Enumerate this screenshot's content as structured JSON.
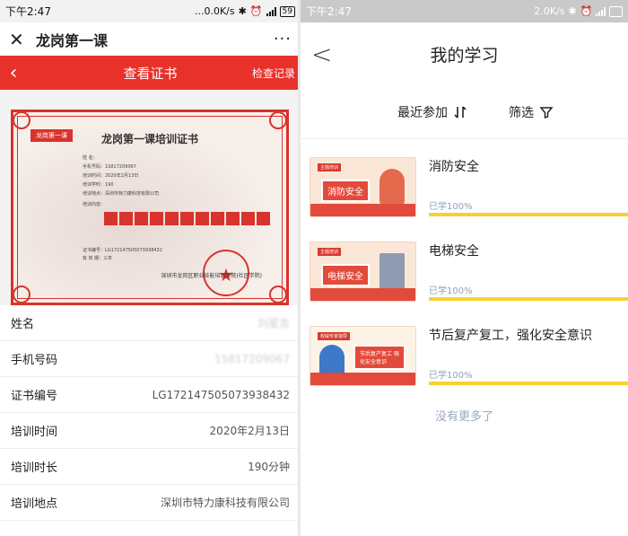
{
  "left": {
    "status": {
      "time": "下午2:47",
      "net": "...0.0K/s",
      "battery": "59"
    },
    "wechat": {
      "title": "龙岗第一课",
      "more": "···"
    },
    "cert_page": {
      "title": "查看证书",
      "right_link": "检查记录"
    },
    "certificate": {
      "header": "龙岗第一课培训证书",
      "corner_stamp": "龙岗第一课",
      "lines": [
        "姓 名：",
        "手机号码：1S817209067",
        "培训时间：2020年2月13日",
        "培训学时：190",
        "培训地点：深圳市特力康科技有限公司",
        "培训内容："
      ],
      "cert_no_line": "证书编号：LG172147505073938432",
      "validity_line": "有 效 期：三年",
      "issuer": "深圳市龙岗区职业技能培训学院(社区学院)"
    },
    "rows": [
      {
        "label": "姓名",
        "value": "刘星龙",
        "blurred": true
      },
      {
        "label": "手机号码",
        "value": "15817209067",
        "blurred": true
      },
      {
        "label": "证书编号",
        "value": "LG172147505073938432",
        "blurred": false
      },
      {
        "label": "培训时间",
        "value": "2020年2月13日",
        "blurred": false
      },
      {
        "label": "培训时长",
        "value": "190分钟",
        "blurred": false
      },
      {
        "label": "培训地点",
        "value": "深圳市特力康科技有限公司",
        "blurred": false
      }
    ]
  },
  "right": {
    "status": {
      "time": "下午2:47",
      "net": "2.0K/s"
    },
    "header": {
      "title": "我的学习"
    },
    "filters": {
      "sort_label": "最近参加",
      "filter_label": "筛选"
    },
    "courses": [
      {
        "title": "消防安全",
        "progress_text": "已学100%",
        "progress": 1.0,
        "thumb_tag": "主题培训",
        "thumb_text": "消防安全"
      },
      {
        "title": "电梯安全",
        "progress_text": "已学100%",
        "progress": 1.0,
        "thumb_tag": "主题培训",
        "thumb_text": "电梯安全"
      },
      {
        "title": "节后复产复工，强化安全意识",
        "progress_text": "已学100%",
        "progress": 1.0,
        "thumb_tag": "权威专家指导",
        "thumb_text": "节后复产复工 强化安全意识"
      }
    ],
    "footer": {
      "no_more": "没有更多了"
    }
  }
}
